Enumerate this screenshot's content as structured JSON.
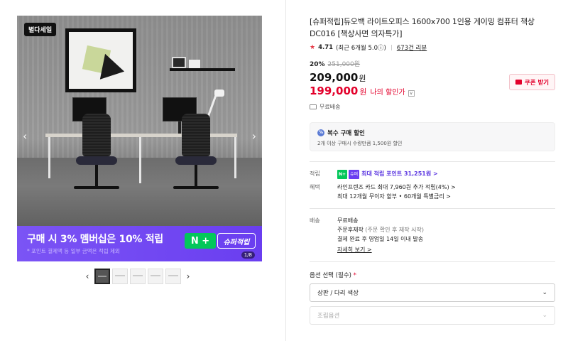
{
  "gallery": {
    "logo_badge": "별다세일",
    "banner_title": "구매 시 3% 멤버십은 10% 적립",
    "banner_sub": "* 포인트 결제액 등 일부 금액은 적립 제외",
    "np_badge": "N +",
    "super_badge": "슈퍼적립",
    "counter": "1/8",
    "prev_arrow": "‹",
    "next_arrow": "›",
    "thumb_count": 5
  },
  "product": {
    "title": "[슈퍼적립]듀오백 라이트오피스 1600x700 1인용 게이밍 컴퓨터 책상 DC016 [책상사면 의자특가]",
    "rating": "4.71",
    "rating_note": "(최근 6개월 5.0ⓘ)",
    "review_count": "673건 리뷰",
    "discount": "20%",
    "original_price": "251,000원",
    "price": "209,000",
    "price_unit": "원",
    "sale_price": "199,000",
    "sale_unit": "원",
    "my_sale_label": "나의 할인가",
    "coupon_label": "쿠폰 받기",
    "shipping_short": "무료배송"
  },
  "multi": {
    "title": "복수 구매 할인",
    "desc": "2개 이상 구매시 수량만큼 1,500원 할인"
  },
  "benefits": {
    "point_label": "적립",
    "np_mini": "N+",
    "super_mini": "슈퍼",
    "point_value": "최대 적립 포인트 31,251원 >",
    "benefit_label": "혜택",
    "benefit_line1": "라인프렌즈 카드 최대 7,960원 추가 적립(4%) >",
    "benefit_line2": "최대 12개월 무이자 할부 • 60개월 특별금리 >"
  },
  "delivery": {
    "label": "배송",
    "line1": "무료배송",
    "line2": "주문후제작",
    "line2_note": "(주문 확인 후 제작 시작)",
    "line3": "결제 완료 후 영업일 14일 이내 발송",
    "detail_link": "자세히 보기 >"
  },
  "options": {
    "label": "옵션 선택 (필수)",
    "required_mark": "*",
    "select1": "상판 / 다리 색상",
    "select2": "조립옵션",
    "chevron": "⌄"
  },
  "colors": {
    "accent_red": "#e3002b",
    "naver_green": "#03c75a",
    "super_purple": "#6a3ef0"
  }
}
